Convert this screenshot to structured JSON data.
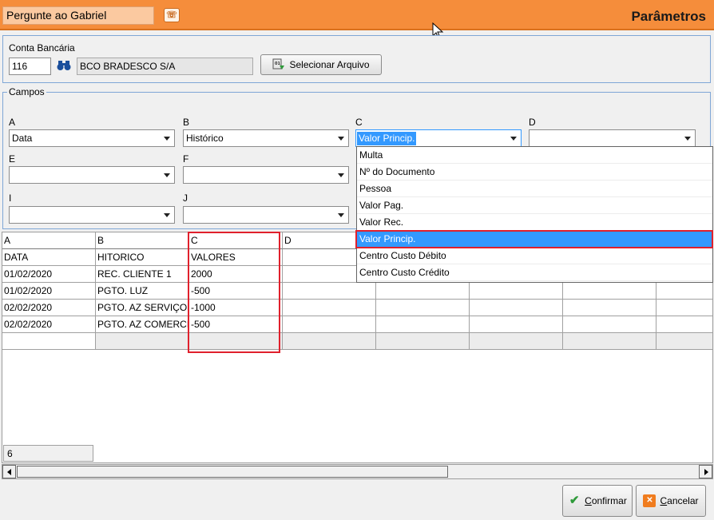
{
  "header": {
    "ask_label": "Pergunte ao Gabriel",
    "ask_icon": "assistant-icon",
    "title": "Parâmetros"
  },
  "bank": {
    "legend": "Conta Bancária",
    "code": "116",
    "name": "BCO BRADESCO S/A",
    "select_file_label": "Selecionar Arquivo"
  },
  "fields": {
    "legend": "Campos",
    "A": {
      "label": "A",
      "value": "Data"
    },
    "B": {
      "label": "B",
      "value": "Histórico"
    },
    "C": {
      "label": "C",
      "value": "Valor Princip."
    },
    "D": {
      "label": "D",
      "value": ""
    },
    "E": {
      "label": "E",
      "value": ""
    },
    "F": {
      "label": "F",
      "value": ""
    },
    "I": {
      "label": "I",
      "value": ""
    },
    "J": {
      "label": "J",
      "value": ""
    }
  },
  "dropdown": {
    "options": [
      "Multa",
      "Nº do Documento",
      "Pessoa",
      "Valor Pag.",
      "Valor Rec.",
      "Valor Princip.",
      "Centro Custo Débito",
      "Centro Custo Crédito"
    ],
    "highlighted_index": 5
  },
  "grid": {
    "headers": [
      "A",
      "B",
      "C",
      "D"
    ],
    "rows": [
      [
        "DATA",
        "HITORICO",
        "VALORES"
      ],
      [
        "01/02/2020",
        "REC. CLIENTE 1",
        "2000"
      ],
      [
        "01/02/2020",
        "PGTO. LUZ",
        "-500"
      ],
      [
        "02/02/2020",
        "PGTO.  AZ SERVIÇOS",
        "-1000"
      ],
      [
        "02/02/2020",
        "PGTO. AZ COMERCIO",
        "-500"
      ],
      [
        "",
        "",
        ""
      ]
    ],
    "row_count": "6"
  },
  "footer": {
    "confirm_label": "Confirmar",
    "cancel_label": "Cancelar"
  },
  "colors": {
    "header_orange": "#f58d3b",
    "selection_blue": "#3399ff",
    "highlight_red": "#e0202c"
  }
}
